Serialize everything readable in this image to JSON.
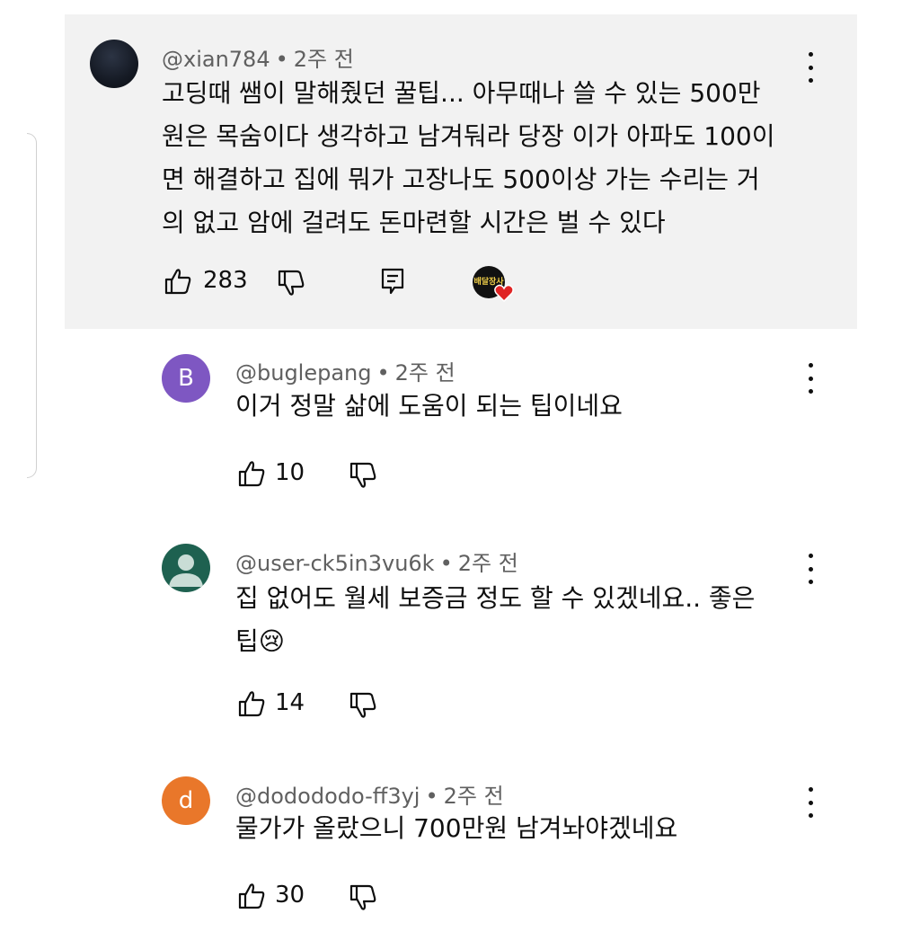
{
  "main": {
    "username": "@xian784",
    "time": "2주 전",
    "lines": [
      "고딩때 쌤이 말해줬던 꿀팁... 아무때나 쓸 수 있는 500만",
      "원은 목숨이다 생각하고 남겨둬라 당장 이가 아파도 100이",
      "면 해결하고 집에 뭐가 고장나도 500이상 가는 수리는 거",
      "의 없고 암에 걸려도 돈마련할 시간은 벌 수 있다"
    ],
    "likes": "283",
    "creator_badge_text": "배달장사"
  },
  "replies": [
    {
      "username": "@buglepang",
      "time": "2주 전",
      "avatar_letter": "B",
      "lines": [
        "이거 정말 삶에 도움이 되는 팁이네요"
      ],
      "likes": "10"
    },
    {
      "username": "@user-ck5in3vu6k",
      "time": "2주 전",
      "avatar_letter": "",
      "lines": [
        "집 없어도 월세 보증금 정도 할 수 있겠네요.. 좋은",
        "팁😢"
      ],
      "likes": "14"
    },
    {
      "username": "@dodododo-ff3yj",
      "time": "2주 전",
      "avatar_letter": "d",
      "lines": [
        "물가가 올랐으니 700만원 남겨놔야겠네요"
      ],
      "likes": "30"
    }
  ],
  "separator": "•",
  "colors": {
    "highlight_bg": "#f2f2f2",
    "meta_text": "#606060",
    "avatar_b": "#7e57c2",
    "avatar_user": "#1e6150",
    "avatar_d": "#e9772a"
  },
  "icons": [
    "like-icon",
    "dislike-icon",
    "reply-icon",
    "more-options-icon",
    "heart-icon"
  ]
}
